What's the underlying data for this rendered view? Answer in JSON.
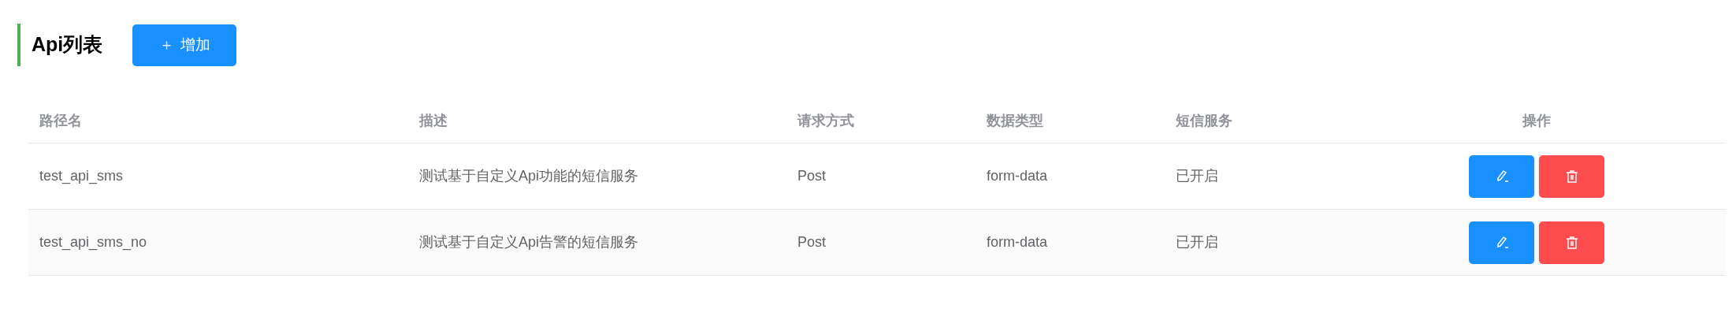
{
  "header": {
    "title": "Api列表",
    "add_button": {
      "icon": "＋",
      "label": "增加"
    }
  },
  "table": {
    "columns": [
      "路径名",
      "描述",
      "请求方式",
      "数据类型",
      "短信服务",
      "操作"
    ],
    "rows": [
      {
        "path": "test_api_sms",
        "description": "测试基于自定义Api功能的短信服务",
        "method": "Post",
        "data_type": "form-data",
        "sms": "已开启"
      },
      {
        "path": "test_api_sms_no",
        "description": "测试基于自定义Api告警的短信服务",
        "method": "Post",
        "data_type": "form-data",
        "sms": "已开启"
      }
    ]
  }
}
